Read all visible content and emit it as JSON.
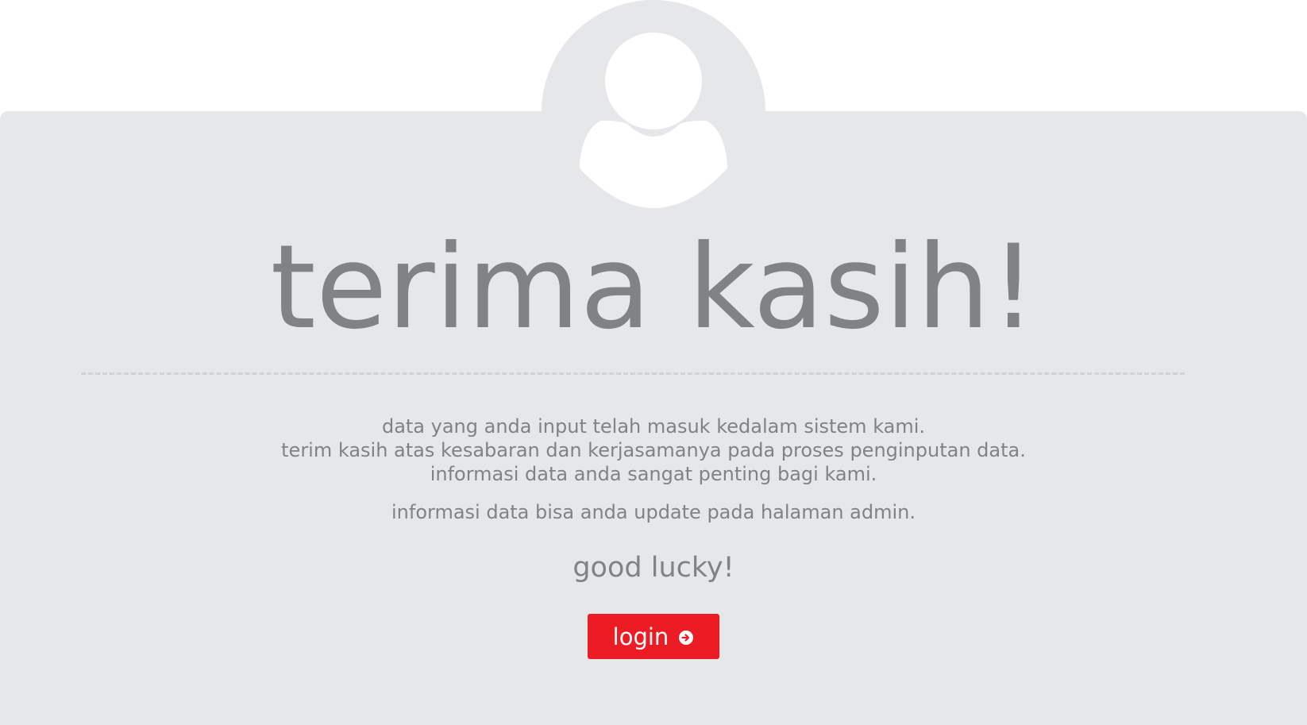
{
  "title": "terima kasih!",
  "messages": {
    "line1": "data yang anda input telah masuk kedalam sistem kami.",
    "line2": "terim kasih atas kesabaran dan kerjasamanya pada proses penginputan data.",
    "line3": "informasi data anda sangat penting bagi kami.",
    "admin_note": "informasi data bisa anda update pada halaman admin.",
    "closing": "good lucky!"
  },
  "login_button": {
    "label": "login",
    "icon": "arrow-circle-right-icon"
  },
  "avatar": {
    "icon": "user-icon"
  },
  "colors": {
    "background": "#ffffff",
    "card": "#e6e7e9",
    "text": "#808285",
    "divider": "#d1d3d4",
    "accent": "#ec1c24",
    "button_text": "#ffffff"
  }
}
